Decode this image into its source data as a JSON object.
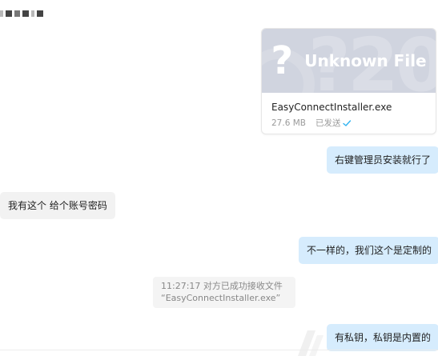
{
  "file_card": {
    "banner_icon": "question-mark-icon",
    "banner_label": "Unknown File",
    "file_name": "EasyConnectInstaller.exe",
    "file_size": "27.6 MB",
    "status": "已发送",
    "status_color": "#2fb3f0"
  },
  "messages": [
    {
      "direction": "out",
      "text": "右键管理员安装就行了"
    },
    {
      "direction": "in",
      "text": "我有这个 给个账号密码"
    },
    {
      "direction": "out",
      "text": "不一样的，我们这个是定制的"
    },
    {
      "direction": "out",
      "text": "有私钥，私钥是内置的"
    }
  ],
  "system_note": {
    "line1": "11:27:17 对方已成功接收文件",
    "line2": "“EasyConnectInstaller.exe”"
  },
  "colors": {
    "outgoing_bubble": "#d6ecfd",
    "incoming_bubble": "#f2f2f2",
    "banner": "#d0d4df"
  }
}
